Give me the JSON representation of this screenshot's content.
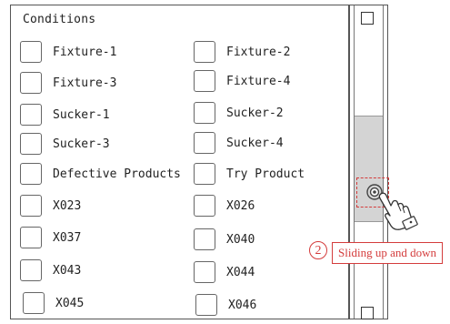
{
  "panel": {
    "title": "Conditions"
  },
  "conditions": [
    {
      "left": "Fixture-1",
      "right": "Fixture-2"
    },
    {
      "left": "Fixture-3",
      "right": "Fixture-4"
    },
    {
      "left": "Sucker-1",
      "right": "Sucker-2"
    },
    {
      "left": "Sucker-3",
      "right": "Sucker-4"
    },
    {
      "left": "Defective Products",
      "right": "Try Product"
    },
    {
      "left": "X023",
      "right": "X026"
    },
    {
      "left": "X037",
      "right": "X040"
    },
    {
      "left": "X043",
      "right": "X044"
    },
    {
      "left": "X045",
      "right": "X046"
    }
  ],
  "annotation": {
    "step_number": "2",
    "text": "Sliding up and down",
    "color": "#d43c3c"
  },
  "icons": {
    "hand": "pointing-hand-icon",
    "knob": "drag-knob-icon"
  }
}
